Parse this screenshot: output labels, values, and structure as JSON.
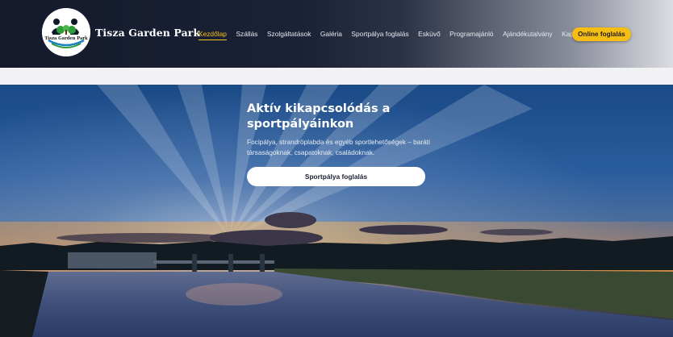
{
  "brand": {
    "logo_text": "Tisza Garden Park",
    "name": "Tisza Garden Park"
  },
  "nav": {
    "items": [
      {
        "label": "Kezdőlap",
        "active": true
      },
      {
        "label": "Szállás"
      },
      {
        "label": "Szolgáltatások"
      },
      {
        "label": "Galéria"
      },
      {
        "label": "Sportpálya foglalás"
      },
      {
        "label": "Esküvő"
      },
      {
        "label": "Programajánló"
      },
      {
        "label": "Ajándékutalvány"
      },
      {
        "label": "Kapcsolat"
      }
    ],
    "cta_label": "Online foglalás"
  },
  "hero": {
    "title": "Aktív kikapcsolódás a sportpályáinkon",
    "subtitle": "Focipálya, strandröplabda és egyéb sportlehetőségek – baráti társaságoknak, csapatoknak, családoknak.",
    "button_label": "Sportpálya foglalás"
  },
  "colors": {
    "accent": "#f6bd12",
    "header_dark": "#141a2b",
    "active_nav": "#f7c31b"
  }
}
